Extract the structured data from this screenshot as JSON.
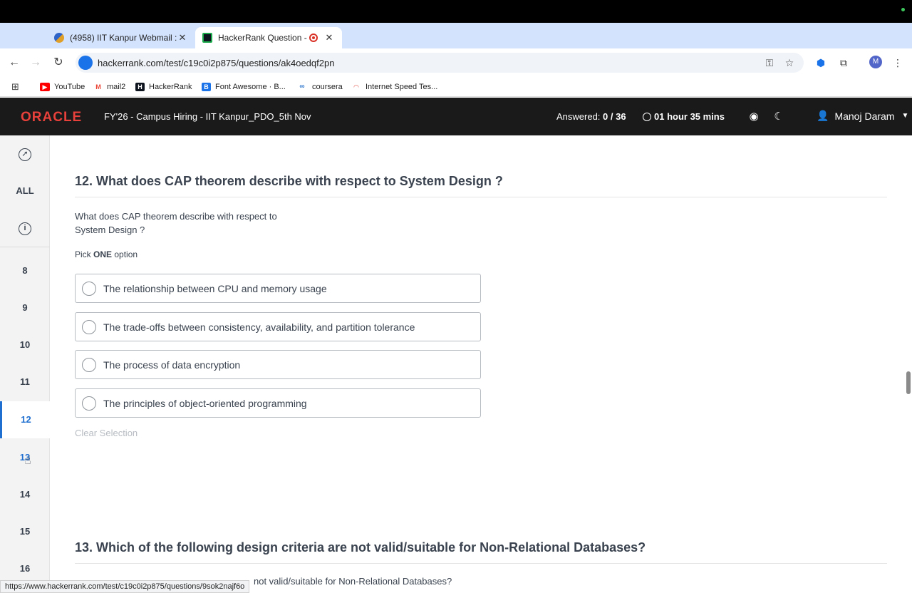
{
  "browser": {
    "tabs": [
      {
        "title": "(4958) IIT Kanpur Webmail ::",
        "close": "✕"
      },
      {
        "title": "HackerRank Question - W",
        "close": "✕"
      }
    ],
    "new_tab": "+",
    "url": "hackerrank.com/test/c19c0i2p875/questions/ak4oedqf2pn",
    "profile_initial": "M",
    "bookmarks": [
      {
        "label": "YouTube",
        "icon": "youtube-icon",
        "color": "#ff0000"
      },
      {
        "label": "mail2",
        "icon": "gmail-icon",
        "color": "#ea4335"
      },
      {
        "label": "HackerRank",
        "icon": "hackerrank-icon",
        "color": "#0e141e"
      },
      {
        "label": "Font Awesome · B...",
        "icon": "fontawesome-icon",
        "color": "#1a73e8"
      },
      {
        "label": "coursera",
        "icon": "coursera-icon",
        "color": "#2a73cc"
      },
      {
        "label": "Internet Speed Tes...",
        "icon": "speedtest-icon",
        "color": "#e0443a"
      }
    ],
    "status_url": "https://www.hackerrank.com/test/c19c0i2p875/questions/9sok2najf6o"
  },
  "header": {
    "logo": "ORACLE",
    "test_title": "FY'26 - Campus Hiring - IIT Kanpur_PDO_5th Nov",
    "answered_label": "Answered:",
    "answered_value": "0 / 36",
    "timer": "01 hour 35 mins",
    "user_name": "Manoj Daram",
    "accent": "#e8403a"
  },
  "sidebar": {
    "all_label": "ALL",
    "numbers": [
      "8",
      "9",
      "10",
      "11",
      "12",
      "13",
      "14",
      "15",
      "16"
    ],
    "active": "12",
    "active_color": "#1f6fd0"
  },
  "question12": {
    "title": "12. What does CAP theorem describe with respect to System Design ?",
    "text_line1": "What does CAP theorem describe with respect to",
    "text_line2": "System Design ?",
    "pick_prefix": "Pick",
    "pick_bold": "ONE",
    "pick_suffix": "option",
    "options": [
      "The relationship between CPU and memory usage",
      "The trade-offs between consistency, availability, and partition tolerance",
      "The process of data encryption",
      "The principles of object-oriented programming"
    ],
    "clear_label": "Clear Selection"
  },
  "question13": {
    "title": "13. Which of the following design criteria are not valid/suitable for Non-Relational Databases?",
    "text_partial": "not valid/suitable for Non-Relational Databases?"
  }
}
